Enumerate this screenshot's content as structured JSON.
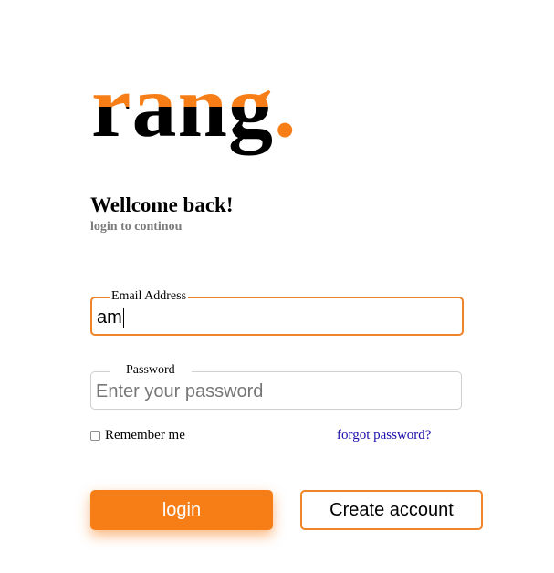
{
  "brand": {
    "name": "rang",
    "dot": ".",
    "accent_color": "#f77e17",
    "dark_color": "#000000"
  },
  "header": {
    "title": "Wellcome back!",
    "subtitle": "login to continou"
  },
  "form": {
    "email": {
      "label": "Email Address",
      "value": "am"
    },
    "password": {
      "label": "Password",
      "value": "",
      "placeholder": "Enter your password"
    },
    "remember_label": "Remember me",
    "remember_checked": false,
    "forgot_label": "forgot password?"
  },
  "actions": {
    "login_label": "login",
    "create_label": "Create account"
  }
}
